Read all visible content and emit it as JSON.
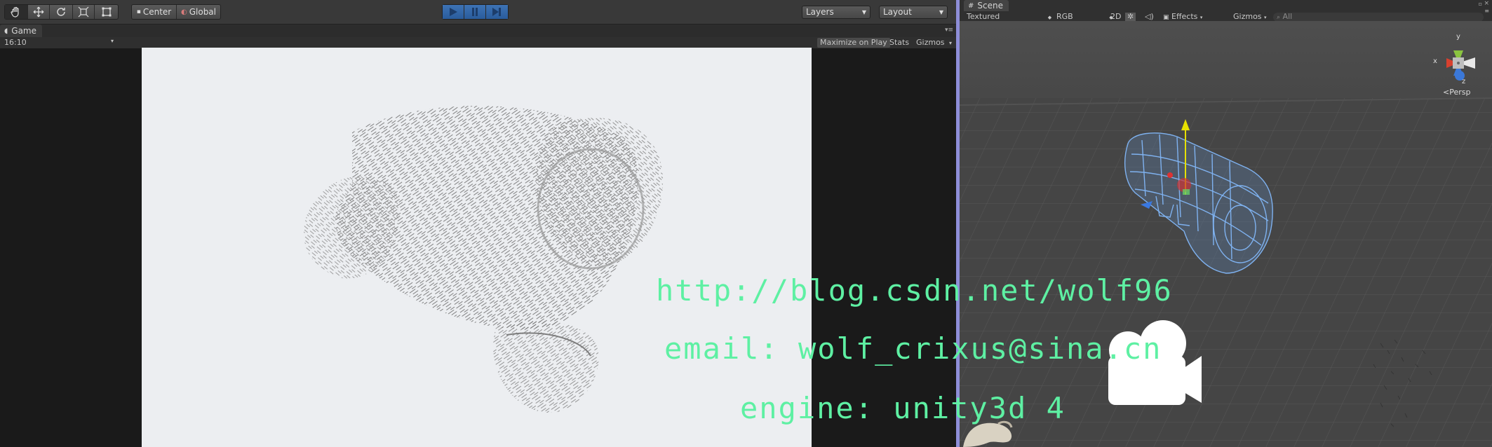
{
  "toolbar": {
    "pivot_label": "Center",
    "rotation_label": "Global",
    "layers_label": "Layers",
    "layout_label": "Layout"
  },
  "game": {
    "tab_label": "Game",
    "aspect_label": "16:10",
    "maximize_label": "Maximize on Play",
    "stats_label": "Stats",
    "gizmos_label": "Gizmos"
  },
  "scene": {
    "tab_label": "Scene",
    "shading_label": "Textured",
    "render_label": "RGB",
    "mode_2d_label": "2D",
    "effects_label": "Effects",
    "gizmos_label": "Gizmos",
    "search_placeholder": "All",
    "persp_label": "Persp",
    "axis_x": "x",
    "axis_y": "y",
    "axis_z": "z"
  },
  "watermark": {
    "line1": "http://blog.csdn.net/wolf96",
    "line2": "email: wolf_crixus@sina.cn",
    "line3": "engine: unity3d 4"
  },
  "colors": {
    "accent": "#8e8ed8",
    "watermark": "#5ef0a3",
    "play": "#3d73b5"
  }
}
